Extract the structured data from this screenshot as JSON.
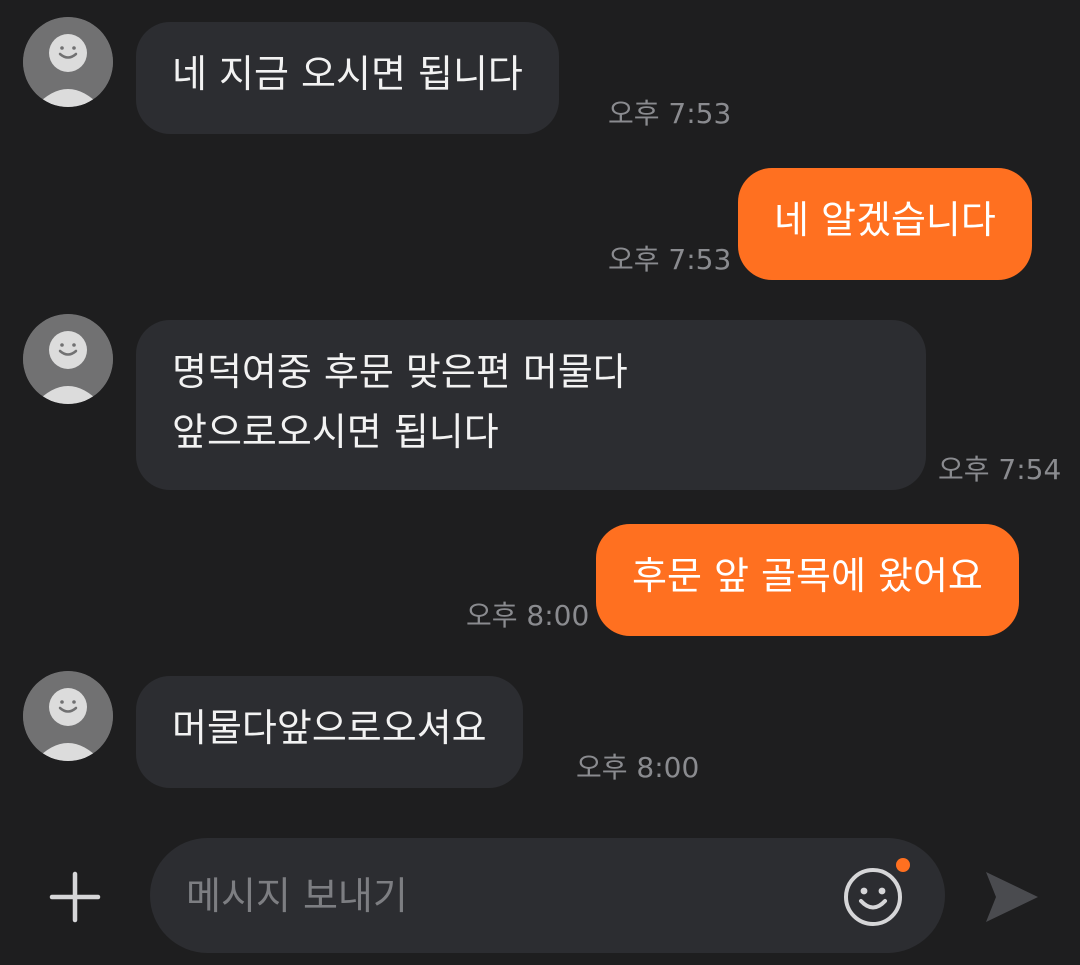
{
  "messages": [
    {
      "direction": "incoming",
      "lines": [
        "네 지금 오시면 됩니다"
      ],
      "time": "오후 7:53"
    },
    {
      "direction": "outgoing",
      "lines": [
        "네 알겠습니다"
      ],
      "time": "오후 7:53"
    },
    {
      "direction": "incoming",
      "lines": [
        "명덕여중 후문 맞은편 머물다",
        "앞으로오시면 됩니다"
      ],
      "time": "오후 7:54"
    },
    {
      "direction": "outgoing",
      "lines": [
        "후문 앞 골목에 왔어요"
      ],
      "time": "오후 8:00"
    },
    {
      "direction": "incoming",
      "lines": [
        "머물다앞으로오셔요"
      ],
      "time": "오후 8:00"
    }
  ],
  "composer": {
    "placeholder": "메시지 보내기",
    "plus_icon": "plus-icon",
    "emoji_icon": "smiley-icon",
    "send_icon": "send-arrow-icon",
    "notification_dot_color": "#ff7020"
  },
  "colors": {
    "background": "#1e1e1f",
    "incoming_bubble": "#2c2d31",
    "outgoing_bubble": "#ff7020",
    "timestamp": "#8a8b8f"
  }
}
